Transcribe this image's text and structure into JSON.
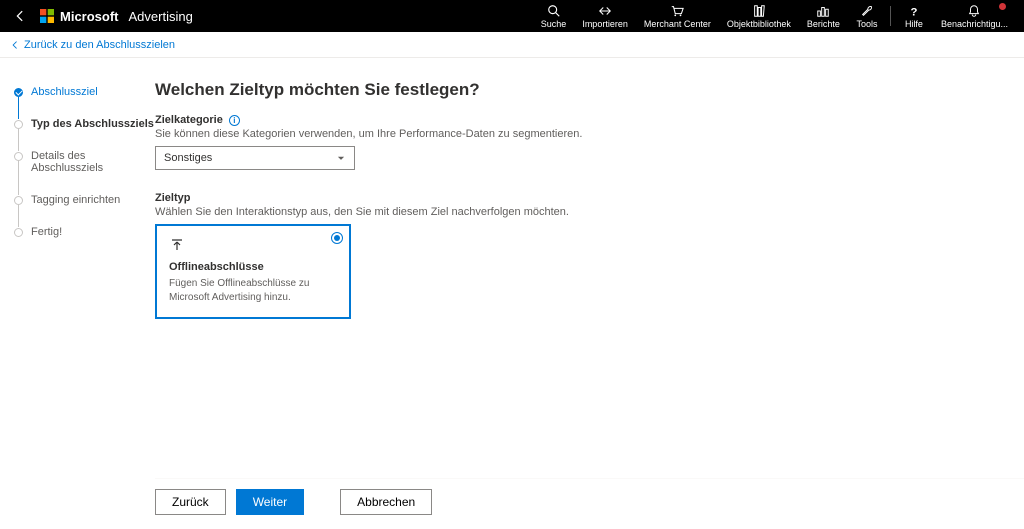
{
  "brand": {
    "microsoft": "Microsoft",
    "advertising": "Advertising"
  },
  "topnav": [
    {
      "icon": "search",
      "label": "Suche"
    },
    {
      "icon": "import",
      "label": "Importieren"
    },
    {
      "icon": "merchant",
      "label": "Merchant Center"
    },
    {
      "icon": "library",
      "label": "Objektbibliothek"
    },
    {
      "icon": "reports",
      "label": "Berichte"
    },
    {
      "icon": "tools",
      "label": "Tools"
    }
  ],
  "topnav_right": [
    {
      "icon": "help",
      "label": "Hilfe"
    },
    {
      "icon": "bell",
      "label": "Benachrichtigu..."
    }
  ],
  "breadcrumb": {
    "back_label": "Zurück zu den Abschlusszielen"
  },
  "sidebar": {
    "steps": [
      {
        "label": "Abschlussziel",
        "state": "done"
      },
      {
        "label": "Typ des Abschlussziels",
        "state": "active"
      },
      {
        "label": "Details des Abschlussziels",
        "state": "pending"
      },
      {
        "label": "Tagging einrichten",
        "state": "pending"
      },
      {
        "label": "Fertig!",
        "state": "pending"
      }
    ]
  },
  "main": {
    "title": "Welchen Zieltyp möchten Sie festlegen?",
    "zielkategorie": {
      "label": "Zielkategorie",
      "desc": "Sie können diese Kategorien verwenden, um Ihre Performance-Daten zu segmentieren.",
      "selected": "Sonstiges"
    },
    "zieltyp": {
      "label": "Zieltyp",
      "desc": "Wählen Sie den Interaktionstyp aus, den Sie mit diesem Ziel nachverfolgen möchten."
    },
    "card": {
      "title": "Offlineabschlüsse",
      "desc": "Fügen Sie Offlineabschlüsse zu Microsoft Advertising hinzu."
    }
  },
  "footer": {
    "back": "Zurück",
    "next": "Weiter",
    "cancel": "Abbrechen"
  }
}
